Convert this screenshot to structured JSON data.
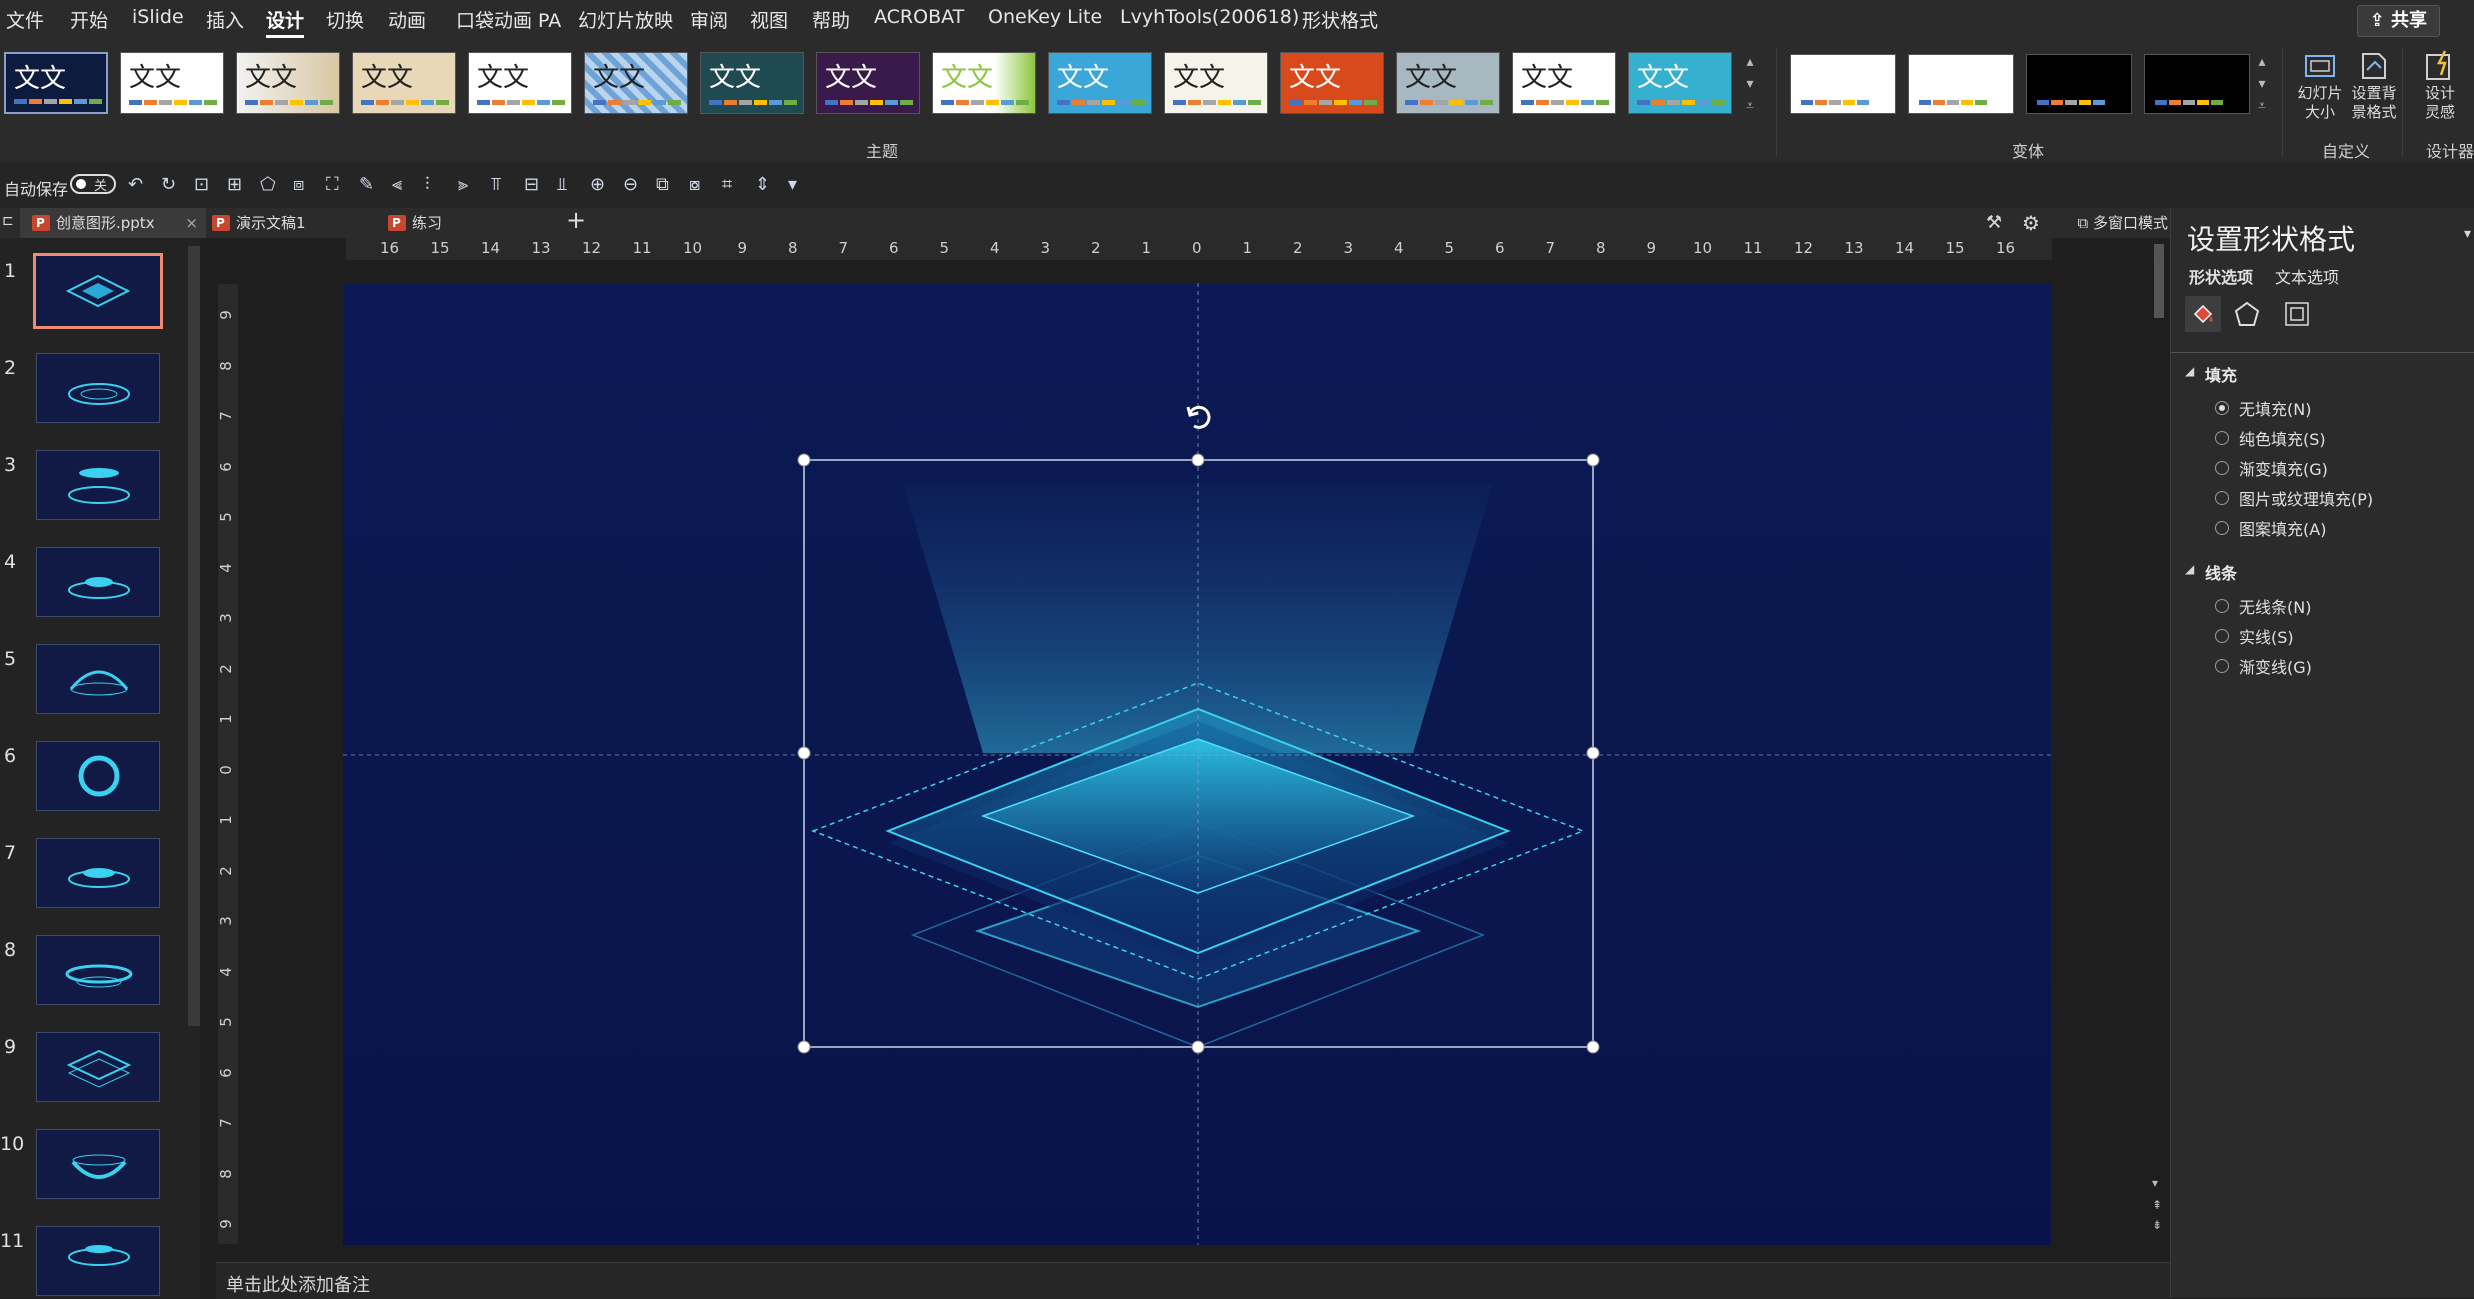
{
  "menu": {
    "items": [
      "文件",
      "开始",
      "iSlide",
      "插入",
      "设计",
      "切换",
      "动画",
      "口袋动画 PA",
      "幻灯片放映",
      "审阅",
      "视图",
      "帮助",
      "ACROBAT",
      "OneKey Lite",
      "LvyhTools(200618)",
      "形状格式"
    ],
    "active": "设计",
    "share_label": "共享"
  },
  "ribbon": {
    "theme_sample_text": "文文",
    "group_themes": "主题",
    "group_variants": "变体",
    "group_customize": "自定义",
    "group_designer": "设计器",
    "slide_size": "幻灯片大小",
    "format_background": "设置背景格式",
    "design_ideas": "设计灵感"
  },
  "qat": {
    "autosave_label": "自动保存",
    "autosave_state": "关"
  },
  "tabs": {
    "items": [
      "创意图形.pptx",
      "演示文稿1",
      "练习"
    ],
    "multi_window": "多窗口模式"
  },
  "thumbnails": {
    "numbers": [
      "1",
      "2",
      "3",
      "4",
      "5",
      "6",
      "7",
      "8",
      "9",
      "10",
      "11"
    ],
    "selected": "1"
  },
  "ruler": {
    "horizontal": [
      "16",
      "15",
      "14",
      "13",
      "12",
      "11",
      "10",
      "9",
      "8",
      "7",
      "6",
      "5",
      "4",
      "3",
      "2",
      "1",
      "0",
      "1",
      "2",
      "3",
      "4",
      "5",
      "6",
      "7",
      "8",
      "9",
      "10",
      "11",
      "12",
      "13",
      "14",
      "15",
      "16"
    ],
    "vertical": [
      "9",
      "8",
      "7",
      "6",
      "5",
      "4",
      "3",
      "2",
      "1",
      "0",
      "1",
      "2",
      "3",
      "4",
      "5",
      "6",
      "7",
      "8",
      "9"
    ]
  },
  "notes": {
    "placeholder": "单击此处添加备注"
  },
  "format_pane": {
    "title": "设置形状格式",
    "tab_shape": "形状选项",
    "tab_text": "文本选项",
    "fill_section": "填充",
    "fill_options": [
      "无填充(N)",
      "纯色填充(S)",
      "渐变填充(G)",
      "图片或纹理填充(P)",
      "图案填充(A)"
    ],
    "fill_selected": "无填充(N)",
    "line_section": "线条",
    "line_options": [
      "无线条(N)",
      "实线(S)",
      "渐变线(G)"
    ]
  },
  "colors": {
    "slide_bg": "#0b1a55",
    "accent_cyan": "#3ad0f0",
    "selection_border": "#f08a70"
  }
}
